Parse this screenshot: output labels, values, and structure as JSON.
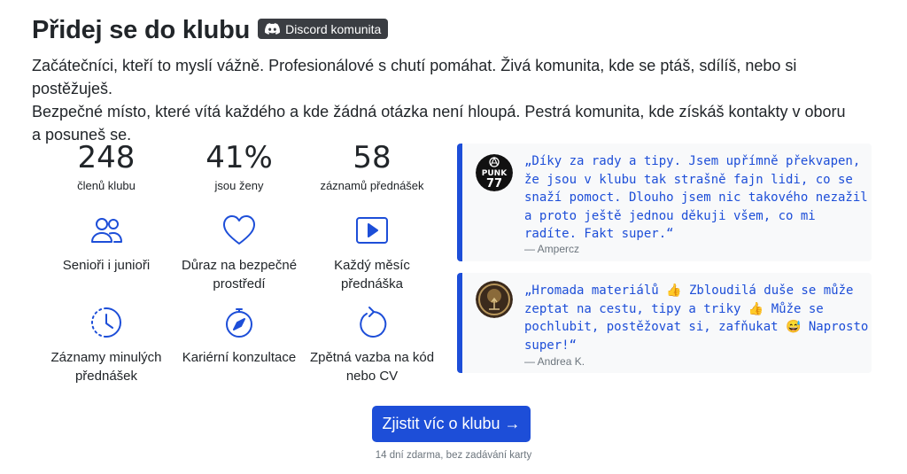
{
  "header": {
    "title": "Přidej se do klubu",
    "badge_label": "Discord komunita",
    "badge_icon": "discord-icon"
  },
  "intro": {
    "line1": "Začátečníci, kteří to myslí vážně. Profesionálové s chutí pomáhat. Živá komunita, kde se ptáš, sdílíš, nebo si postěžuješ.",
    "line2": "Bezpečné místo, které vítá každého a kde žádná otázka není hloupá. Pestrá komunita, kde získáš kontakty v oboru",
    "line3": "a posuneš se."
  },
  "stats": [
    {
      "value": "248",
      "label": "členů klubu"
    },
    {
      "value": "41%",
      "label": "jsou ženy"
    },
    {
      "value": "58",
      "label": "záznamů přednášek"
    }
  ],
  "features": [
    {
      "icon": "people-icon",
      "line1": "Senioři i junioři",
      "line2": ""
    },
    {
      "icon": "heart-icon",
      "line1": "Důraz na bezpečné",
      "line2": "prostředí"
    },
    {
      "icon": "play-icon",
      "line1": "Každý měsíc",
      "line2": "přednáška"
    },
    {
      "icon": "clock-history-icon",
      "line1": "Záznamy minulých",
      "line2": "přednášek"
    },
    {
      "icon": "compass-icon",
      "line1": "Kariérní konzultace",
      "line2": ""
    },
    {
      "icon": "refresh-icon",
      "line1": "Zpětná vazba na kód",
      "line2": "nebo CV"
    }
  ],
  "testimonials": [
    {
      "avatar_text": "PUNK 77",
      "lines": [
        "„Díky za rady a tipy. Jsem upřímně překvapen,",
        "že jsou v klubu tak strašně fajn lidi, co se",
        "snaží pomoct. Dlouho jsem nic takového nezažil",
        "a proto ještě jednou děkuji všem, co mi",
        "radíte. Fakt super.“"
      ],
      "author": "— Ampercz"
    },
    {
      "avatar_text": "",
      "lines": [
        "„Hromada materiálů 👍 Zbloudilá duše se může",
        "zeptat na cestu, tipy a triky 👍 Může se",
        "pochlubit, postěžovat si, zafňukat 😅 Naprosto",
        "super!“"
      ],
      "author": "— Andrea K."
    }
  ],
  "cta": {
    "label": "Zjistit víc o klubu →",
    "note": "14 dní zdarma, bez zadávání karty"
  },
  "colors": {
    "accent": "#1d4ed8",
    "badge_bg": "#3a3d42",
    "card_bg": "#f8f9fa",
    "muted": "#6c757d"
  }
}
